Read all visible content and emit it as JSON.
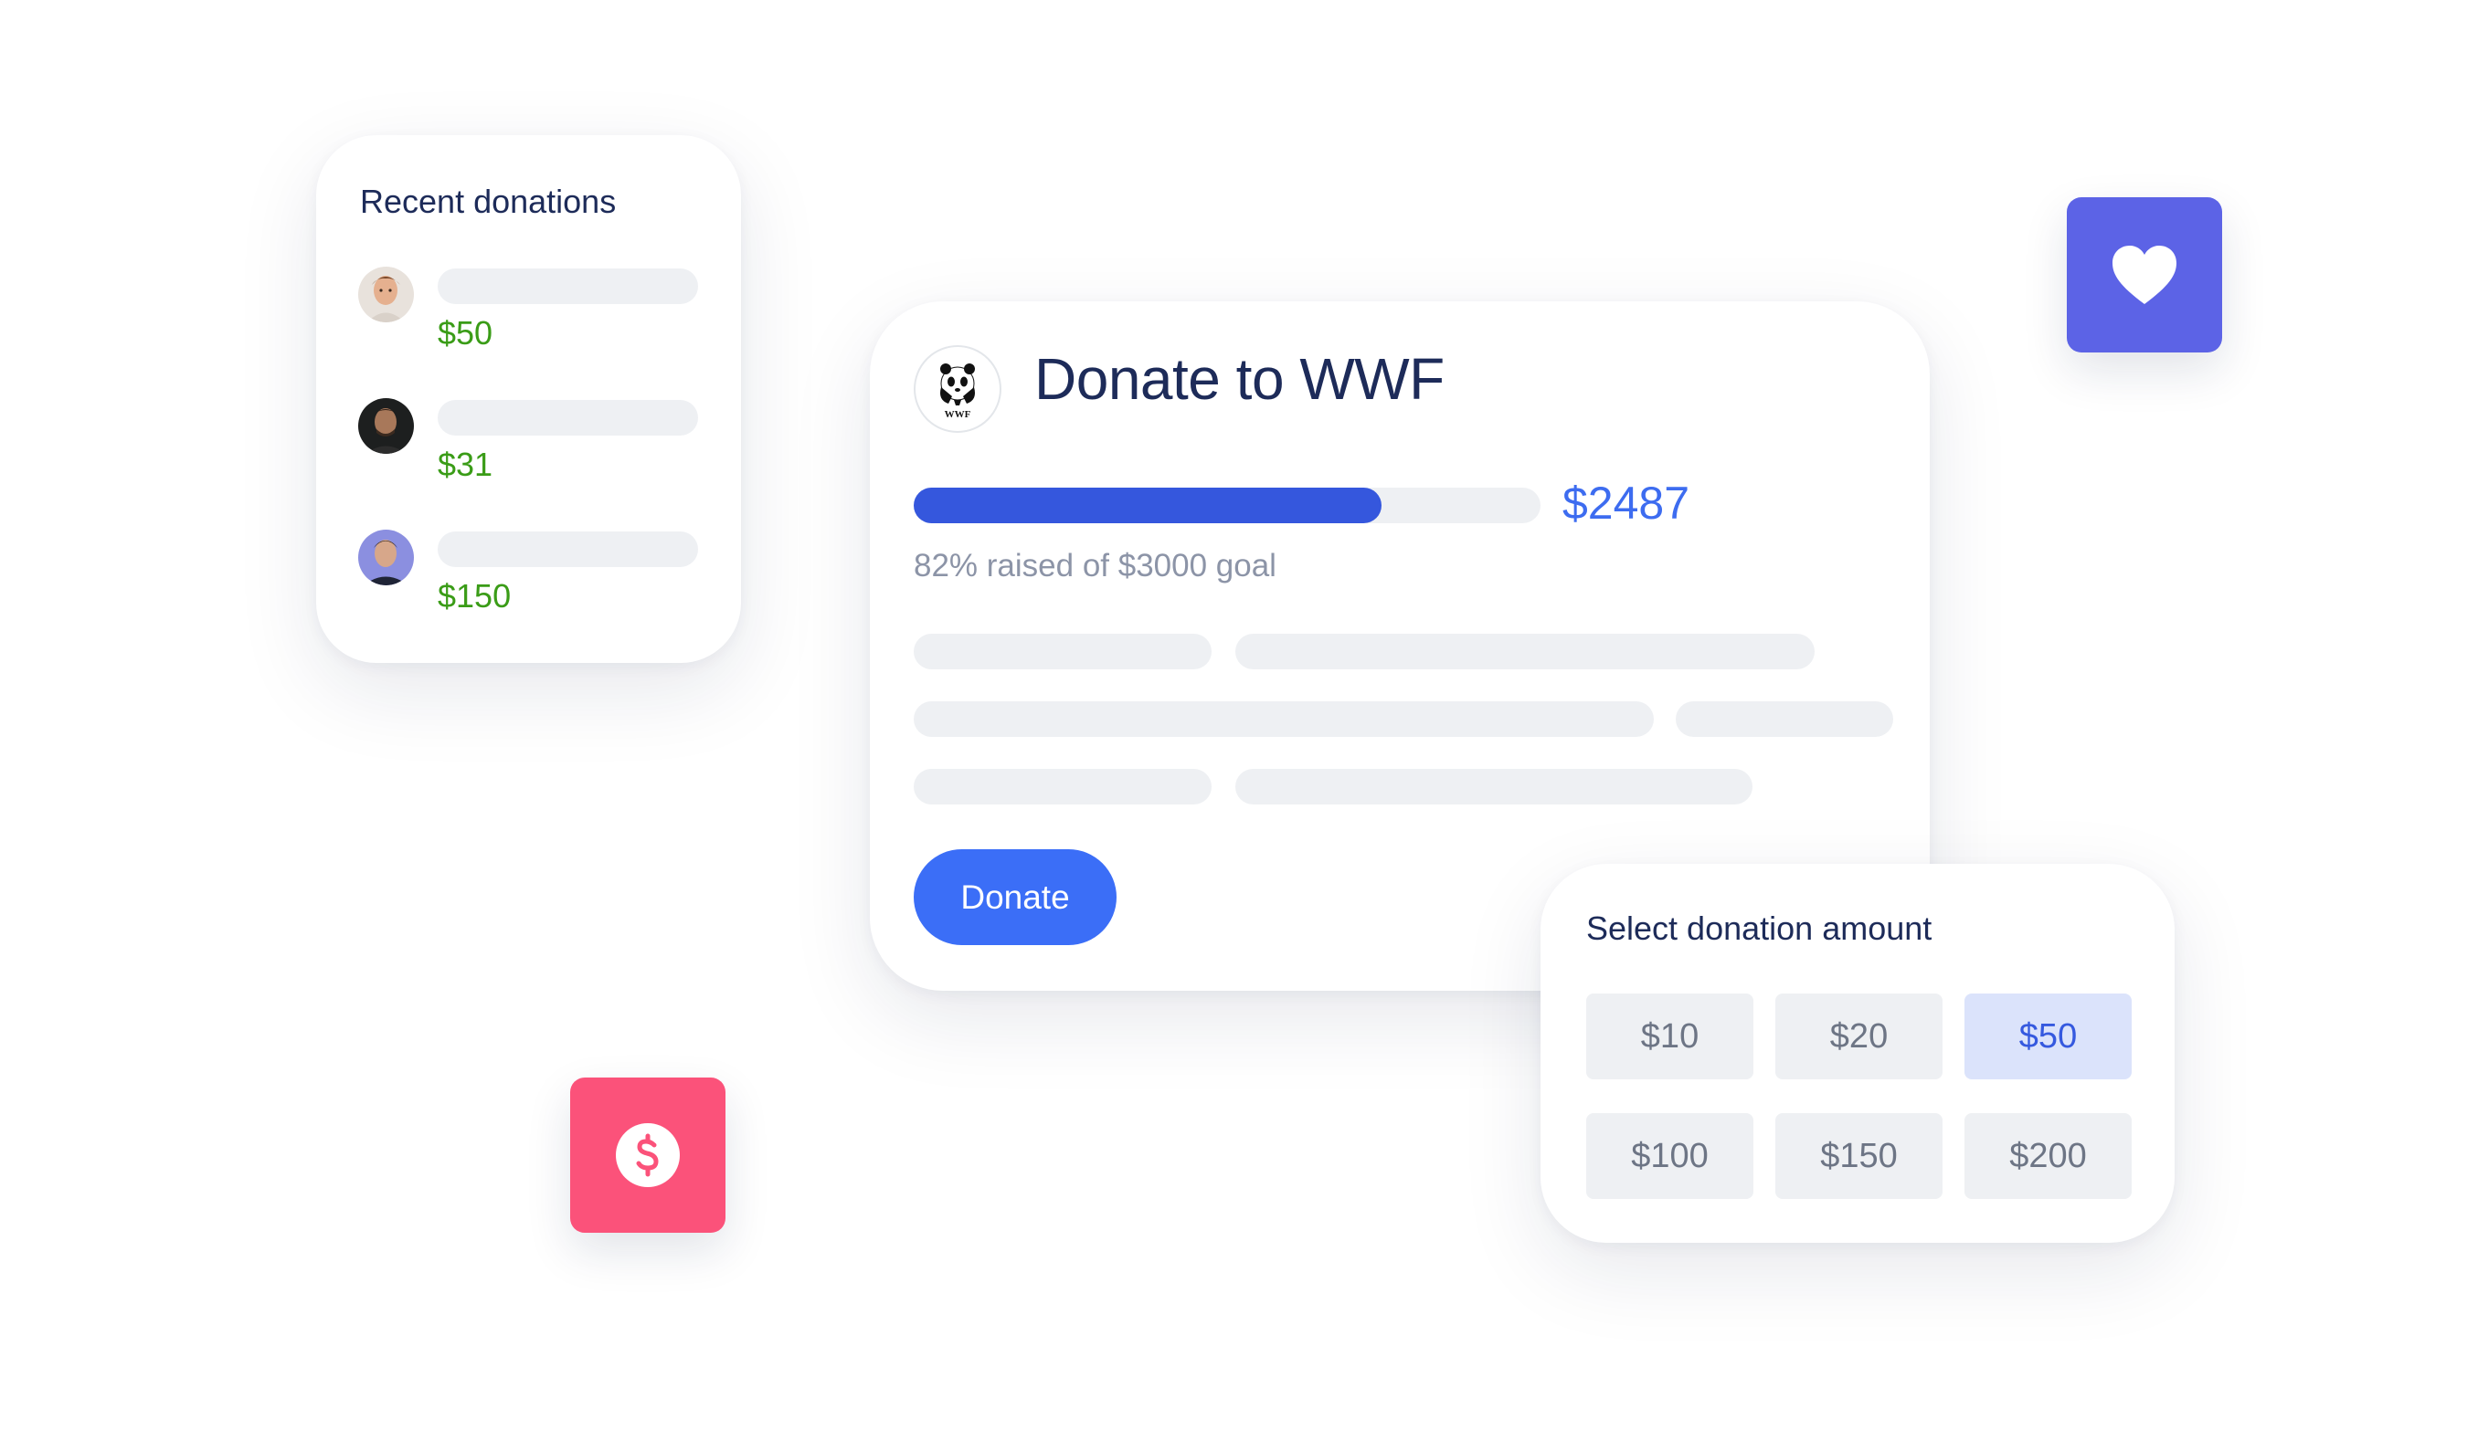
{
  "recent_donations": {
    "title": "Recent donations",
    "items": [
      {
        "amount": "$50"
      },
      {
        "amount": "$31"
      },
      {
        "amount": "$150"
      }
    ]
  },
  "campaign": {
    "title": "Donate to WWF",
    "logo_text": "WWF",
    "raised": "$2487",
    "goal_text": "82% raised of $3000 goal",
    "progress_fraction": 0.746,
    "donate_label": "Donate"
  },
  "amount_selector": {
    "title": "Select donation amount",
    "options": [
      "$10",
      "$20",
      "$50",
      "$100",
      "$150",
      "$200"
    ],
    "selected": "$50"
  },
  "colors": {
    "primary": "#3b6ef7",
    "progress": "#3557dd",
    "amount_green": "#3a9c17",
    "heart_tile": "#5c63e6",
    "dollar_tile": "#fb527a"
  },
  "icons": {
    "heart_tile": "heart-icon",
    "dollar_tile": "dollar-icon",
    "logo": "panda-logo-icon"
  }
}
